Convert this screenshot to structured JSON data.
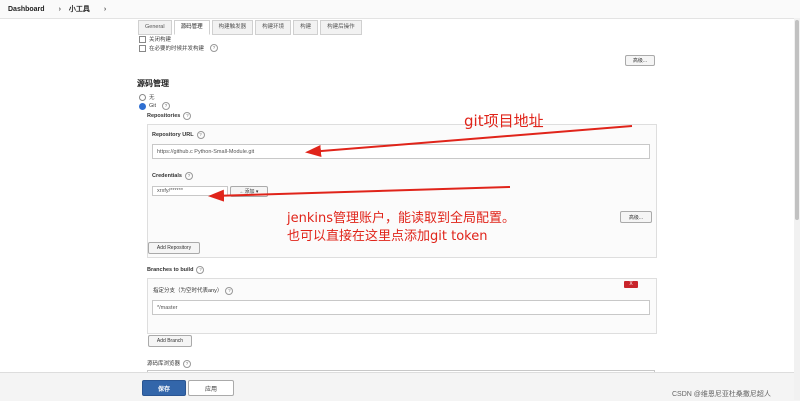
{
  "breadcrumb": {
    "dashboard": "Dashboard",
    "sep1": "›",
    "project": "小工具",
    "sep2": "›"
  },
  "tabs": [
    {
      "label": "General"
    },
    {
      "label": "源码管理"
    },
    {
      "label": "构建触发器"
    },
    {
      "label": "构建环境"
    },
    {
      "label": "构建"
    },
    {
      "label": "构建后操作"
    }
  ],
  "general": {
    "disable_build": "关闭构建",
    "concurrent": "在必要的时候并发构建",
    "advanced": "高级..."
  },
  "scm": {
    "heading": "源码管理",
    "none": "无",
    "git": "Git",
    "repositories": "Repositories",
    "repo_url_label": "Repository URL",
    "repo_url_value": "https://github.c             Python-Small-Module.git",
    "credentials_label": "Credentials",
    "credentials_value": "xrxfy/******",
    "add_label": "←添加 ▾",
    "advanced": "高级...",
    "add_repository": "Add Repository",
    "branches_label": "Branches to build",
    "branch_specifier_label": "指定分支（为空时代表any）",
    "branch_value": "*/master",
    "remove": "X",
    "add_branch": "Add Branch",
    "browser_label": "源码库浏览器"
  },
  "footer": {
    "save": "保存",
    "apply": "应用"
  },
  "annotations": {
    "git_url": "git项目地址",
    "jenkins_1": "jenkins管理账户，能读取到全局配置。",
    "jenkins_2": "也可以直接在这里点添加git token"
  },
  "watermark": "CSDN @维恩尼亚杜桑撒尼超人",
  "colors": {
    "annotation": "#e0241a",
    "primary": "#3366aa"
  }
}
